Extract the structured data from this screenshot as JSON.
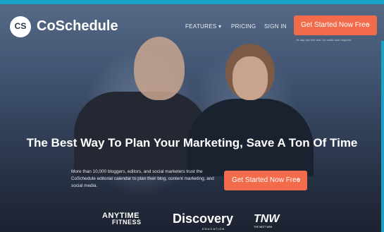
{
  "brand": {
    "logo_initials": "CS",
    "name": "CoSchedule",
    "accent_color": "#f26b4a",
    "top_strip_color": "#1aa2c8"
  },
  "nav": {
    "features_label": "FEATURES",
    "features_caret": "▾",
    "pricing_label": "PRICING",
    "signin_label": "SIGN IN",
    "cta_label": "Get Started Now Free",
    "cta_chevron": "›",
    "trial_note": "14-day risk free trial. No credit card required."
  },
  "hero": {
    "headline": "The Best Way To Plan Your Marketing, Save A Ton Of Time",
    "subtext": "More than 10,000 bloggers, editors, and social marketers trust the CoSchedule editorial calendar to plan their blog, content marketing, and social media.",
    "cta_label": "Get Started Now Free",
    "cta_chevron": "›"
  },
  "partners": {
    "anytime_line1": "ANYTIME",
    "anytime_line2": "FITNESS",
    "discovery_name": "Discovery",
    "discovery_sub": "EDUCATION",
    "tnw_name": "TNW",
    "tnw_sub": "THE NEXT WEB"
  }
}
